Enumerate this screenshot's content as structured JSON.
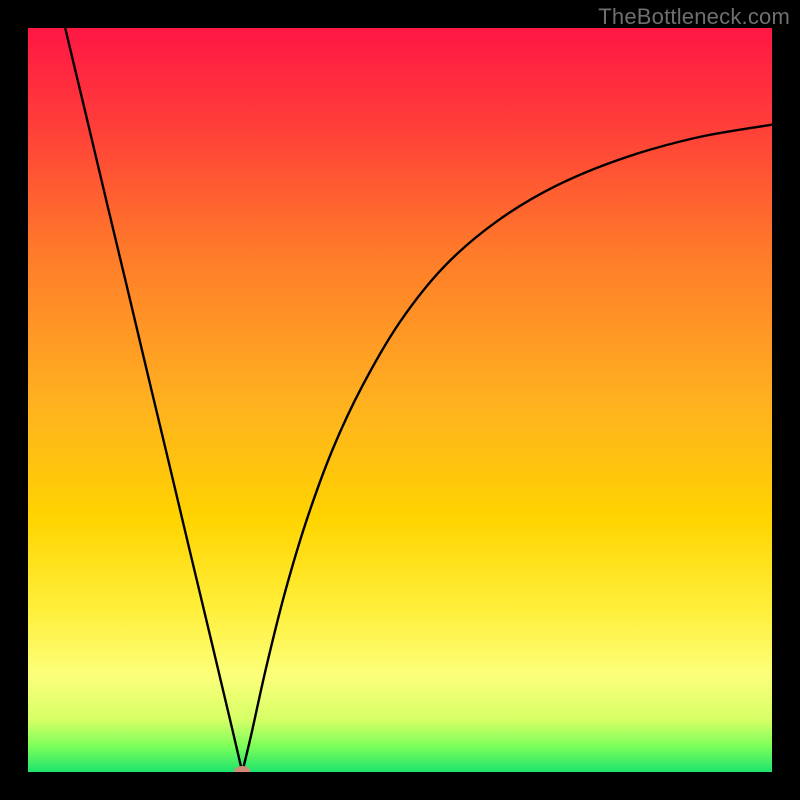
{
  "watermark": "TheBottleneck.com",
  "chart_data": {
    "type": "line",
    "title": "",
    "xlabel": "",
    "ylabel": "",
    "xlim": [
      0,
      100
    ],
    "ylim": [
      0,
      100
    ],
    "grid": false,
    "legend": false,
    "gradient_stops": [
      {
        "offset": 0.0,
        "color": "#ff1744"
      },
      {
        "offset": 0.12,
        "color": "#ff3a3a"
      },
      {
        "offset": 0.3,
        "color": "#ff7a2a"
      },
      {
        "offset": 0.5,
        "color": "#ffb020"
      },
      {
        "offset": 0.66,
        "color": "#ffd400"
      },
      {
        "offset": 0.78,
        "color": "#ffef3a"
      },
      {
        "offset": 0.87,
        "color": "#fcff7a"
      },
      {
        "offset": 0.93,
        "color": "#d6ff66"
      },
      {
        "offset": 0.965,
        "color": "#7dff5a"
      },
      {
        "offset": 1.0,
        "color": "#1de36b"
      }
    ],
    "series": [
      {
        "name": "left-branch",
        "x": [
          5.0,
          7.8,
          10.6,
          13.4,
          16.2,
          19.0,
          21.8,
          24.6,
          27.4,
          28.8
        ],
        "values": [
          100.0,
          88.3,
          76.5,
          64.8,
          53.0,
          41.3,
          29.5,
          17.8,
          6.0,
          0.0
        ]
      },
      {
        "name": "right-branch",
        "x": [
          28.8,
          30.0,
          32.0,
          34.5,
          37.5,
          41.0,
          45.0,
          50.0,
          56.0,
          63.0,
          71.0,
          80.0,
          90.0,
          100.0
        ],
        "values": [
          0.0,
          5.0,
          14.0,
          24.0,
          34.0,
          43.5,
          52.0,
          60.5,
          68.0,
          74.0,
          78.8,
          82.5,
          85.3,
          87.0
        ]
      }
    ],
    "marker": {
      "x": 28.8,
      "y": 0.0,
      "rx": 1.1,
      "ry": 0.8,
      "color": "#cf8a7a"
    }
  }
}
